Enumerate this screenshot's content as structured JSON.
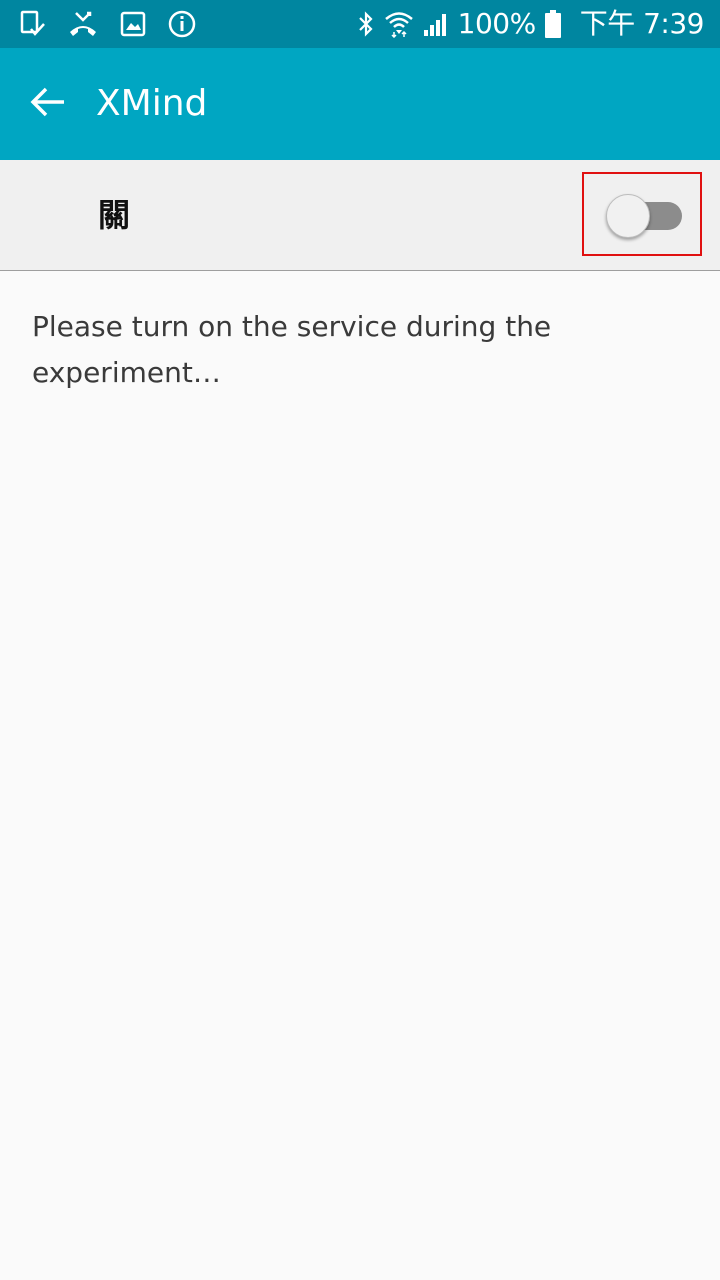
{
  "status_bar": {
    "left_icons": [
      "screenshot-saved-icon",
      "missed-call-icon",
      "gallery-icon",
      "info-icon"
    ],
    "right_icons": [
      "bluetooth-icon",
      "wifi-icon",
      "signal-icon",
      "battery-icon"
    ],
    "battery_text": "100%",
    "time_text": "下午 7:39"
  },
  "app_bar": {
    "back_icon": "arrow-left-icon",
    "title": "XMind",
    "color": "#00a6c2",
    "status_color": "#0086a0"
  },
  "switch_row": {
    "label": "關",
    "state": "off",
    "highlighted": true,
    "highlight_color": "#e01010"
  },
  "content": {
    "description": "Please turn on the service during the experiment…"
  }
}
